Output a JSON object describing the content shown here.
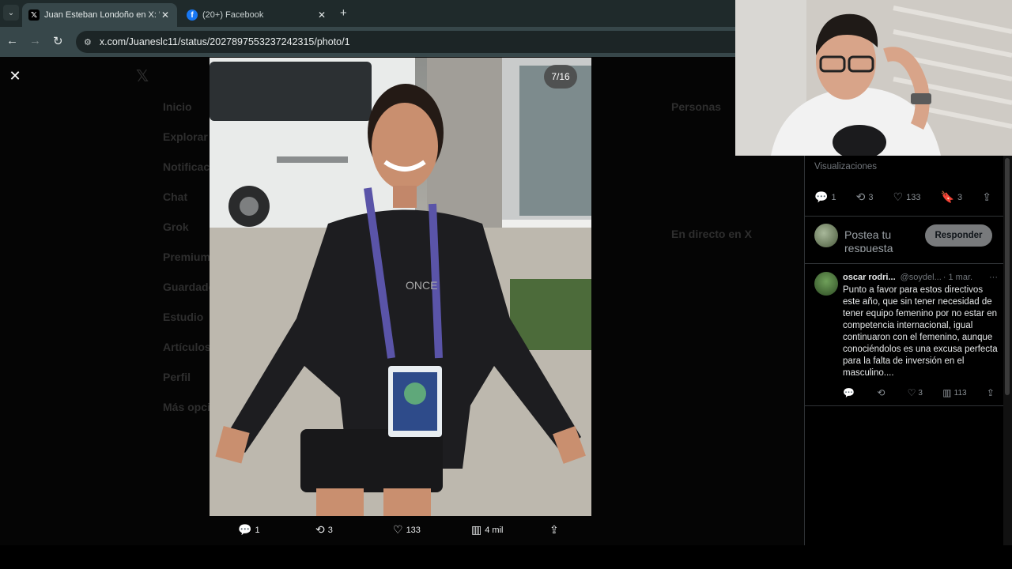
{
  "browser": {
    "tabs": [
      {
        "title": "Juan Esteban Londoño en X: \"El",
        "active": true,
        "icon": "x-logo-icon"
      },
      {
        "title": "(20+) Facebook",
        "active": false,
        "icon": "facebook-icon"
      }
    ],
    "url": "x.com/Juaneslc11/status/2027897553237242315/photo/1"
  },
  "background_page": {
    "nav": [
      "Inicio",
      "Explorar",
      "Notificaciones",
      "Chat",
      "Grok",
      "Premium",
      "Guardados",
      "Estudio",
      "Artículos",
      "Perfil",
      "Más opciones"
    ],
    "right_titles": [
      "Personas",
      "En directo en X"
    ]
  },
  "viewer": {
    "counter": "7/16",
    "actions": {
      "replies": "1",
      "reposts": "3",
      "likes": "133",
      "views": "4 mil"
    }
  },
  "sidebar": {
    "views_label": "Visualizaciones",
    "actions": {
      "replies": "1",
      "reposts": "3",
      "likes": "133",
      "bookmarks": "3"
    },
    "reply_placeholder": "Postea tu respuesta",
    "reply_button": "Responder",
    "comment": {
      "name": "oscar rodri...",
      "handle": "@soydel...",
      "time": "· 1 mar.",
      "more": "···",
      "text": "Punto a favor para estos directivos este año, que sin tener necesidad de tener equipo femenino por no estar en competencia internacional, igual continuaron con el femenino, aunque conociéndolos es una excusa perfecta para la falta de inversión en el masculino....",
      "actions": {
        "reposts": "",
        "likes": "3",
        "views": "113"
      }
    }
  },
  "colors": {
    "accent_bg": "#000000",
    "chrome": "#37474a",
    "reply_button": "#787a7c"
  }
}
